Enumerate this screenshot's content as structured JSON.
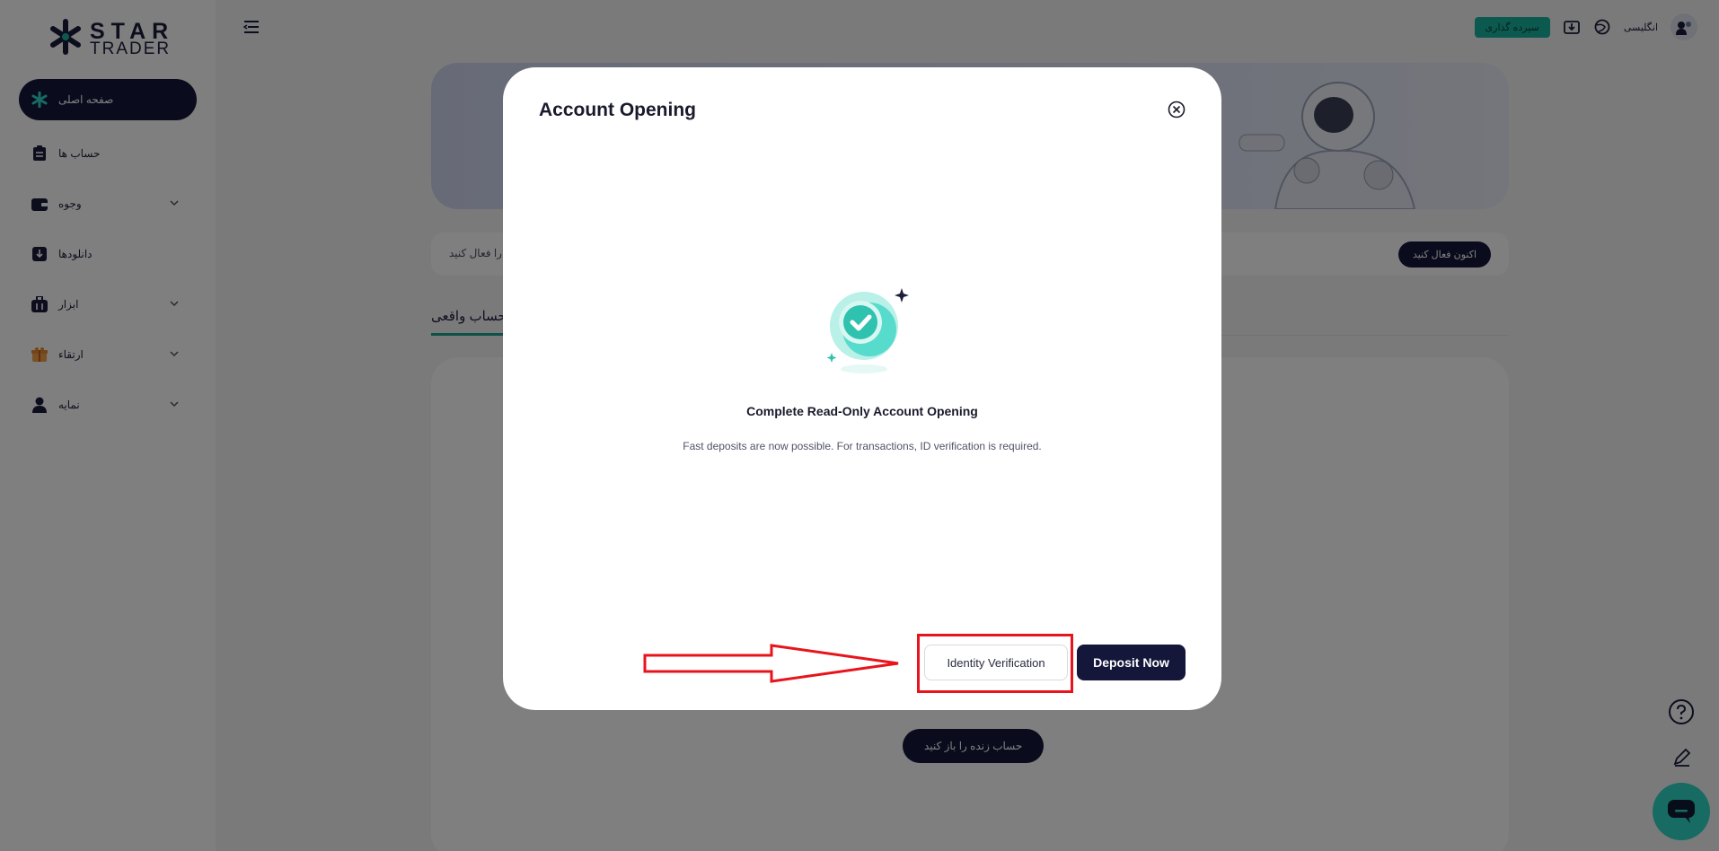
{
  "brand": {
    "name_line1": "STAR",
    "name_line2": "TRADER"
  },
  "sidebar": {
    "items": [
      {
        "label": "صفحه اصلی",
        "icon": "star-logo-icon",
        "active": true,
        "has_chevron": false
      },
      {
        "label": "حساب ها",
        "icon": "clipboard-icon",
        "active": false,
        "has_chevron": false
      },
      {
        "label": "وجوه",
        "icon": "wallet-icon",
        "active": false,
        "has_chevron": true
      },
      {
        "label": "دانلودها",
        "icon": "download-icon",
        "active": false,
        "has_chevron": false
      },
      {
        "label": "ابزار",
        "icon": "toolbox-icon",
        "active": false,
        "has_chevron": true
      },
      {
        "label": "ارتقاء",
        "icon": "gift-icon",
        "active": false,
        "has_chevron": true
      },
      {
        "label": "نمایه",
        "icon": "user-icon",
        "active": false,
        "has_chevron": true
      }
    ]
  },
  "header": {
    "deposit_label": "سپرده گذاری",
    "language_label": "انگلیسی"
  },
  "main": {
    "notice_text": "را فعال کنید",
    "activate_label": "اکنون فعال کنید",
    "tab_label": "حساب واقعی",
    "open_live_label": "حساب زنده را باز کنید"
  },
  "modal": {
    "title": "Account Opening",
    "heading": "Complete Read-Only Account Opening",
    "description": "Fast deposits are now possible. For transactions, ID verification is required.",
    "identity_label": "Identity Verification",
    "deposit_label": "Deposit Now"
  },
  "colors": {
    "primary_dark": "#14163a",
    "accent_teal": "#19b49e",
    "annotation_red": "#e8141c"
  }
}
